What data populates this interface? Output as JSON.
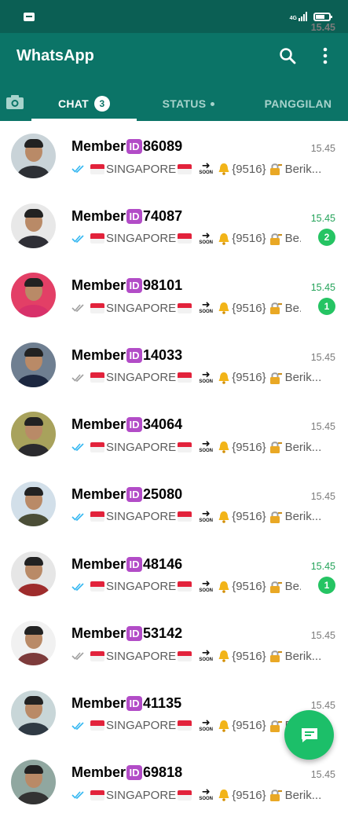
{
  "statusbar": {
    "time": "15.45",
    "network": "4G"
  },
  "header": {
    "title": "WhatsApp",
    "icons": [
      "search-icon",
      "more-vert-icon"
    ]
  },
  "tabs": {
    "camera_icon": "camera-icon",
    "chat_label": "CHAT",
    "chat_badge": "3",
    "status_label": "STATUS",
    "calls_label": "PANGGILAN"
  },
  "colors": {
    "statusbar": "#0b5f54",
    "header": "#0b7467",
    "unread": "#25c463",
    "id_box": "#b24cc7"
  },
  "chat": {
    "name_prefix": "Member",
    "id_glyph": "ID",
    "country": "SINGAPORE",
    "soon": "SOON",
    "code": "{9516}",
    "rows": [
      {
        "number": "86089",
        "time": "15.45",
        "read": true,
        "unread": "",
        "preview_tail": "Berik..."
      },
      {
        "number": "74087",
        "time": "15.45",
        "read": true,
        "unread": "2",
        "preview_tail": "Be..."
      },
      {
        "number": "98101",
        "time": "15.45",
        "read": false,
        "unread": "1",
        "preview_tail": "Be..."
      },
      {
        "number": "14033",
        "time": "15.45",
        "read": false,
        "unread": "",
        "preview_tail": "Berik..."
      },
      {
        "number": "34064",
        "time": "15.45",
        "read": true,
        "unread": "",
        "preview_tail": "Berik..."
      },
      {
        "number": "25080",
        "time": "15.45",
        "read": true,
        "unread": "",
        "preview_tail": "Berik..."
      },
      {
        "number": "48146",
        "time": "15.45",
        "read": true,
        "unread": "1",
        "preview_tail": "Be..."
      },
      {
        "number": "53142",
        "time": "15.45",
        "read": false,
        "unread": "",
        "preview_tail": "Berik..."
      },
      {
        "number": "41135",
        "time": "15.45",
        "read": true,
        "unread": "",
        "preview_tail": "Berik..."
      },
      {
        "number": "69818",
        "time": "15.45",
        "read": true,
        "unread": "",
        "preview_tail": "Berik..."
      }
    ]
  },
  "fab": {
    "icon": "new-chat-icon"
  }
}
